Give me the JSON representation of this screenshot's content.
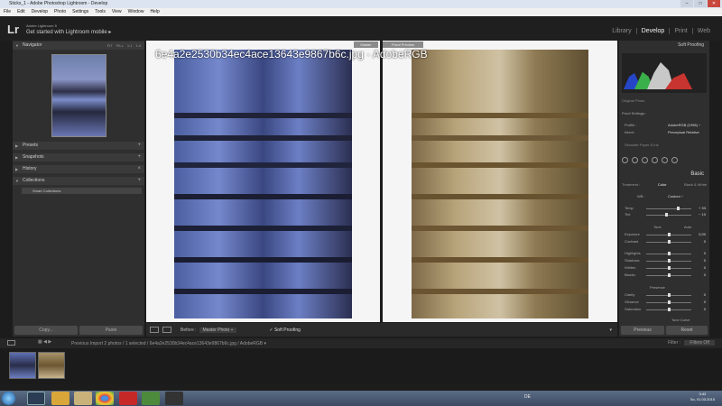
{
  "window": {
    "title": "Sticks_1 - Adobe Photoshop Lightroom - Develop",
    "buttons": [
      "–",
      "□",
      "✕"
    ]
  },
  "menu": [
    "File",
    "Edit",
    "Develop",
    "Photo",
    "Settings",
    "Tools",
    "View",
    "Window",
    "Help"
  ],
  "identity": {
    "logo": "Lr",
    "line1": "Adobe Lightroom 5",
    "line2": "Get started with Lightroom mobile ▸"
  },
  "modules": [
    {
      "label": "Library"
    },
    {
      "label": "Develop"
    },
    {
      "label": "Print"
    },
    {
      "label": "Web"
    }
  ],
  "left_panel": {
    "navigator": {
      "label": "Navigator",
      "zoom": [
        "FIT",
        "FILL",
        "1:1",
        "1:4"
      ]
    },
    "presets": "Presets",
    "snapshots": "Snapshots",
    "history": "History",
    "collections": "Collections",
    "smart_collections": "Smart Collections",
    "copy": "Copy...",
    "paste": "Paste"
  },
  "center": {
    "before_label": "Master",
    "after_label": "Proof Preview",
    "filename_overlay": "6e4a2e2530b34ec4ace13643e9867b6c.jpg · AdobeRGB"
  },
  "toolbar": {
    "before": "Before :",
    "before_value": "Master Photo ÷",
    "soft_proofing": "✓ Soft Proofing",
    "dropdown": "▾"
  },
  "right_panel": {
    "soft_proofing": "Soft Proofing",
    "original_photo": "Original Photo",
    "proof_settings": "Proof Settings :",
    "profile_label": "Profile :",
    "profile_value": "AdobeRGB (1998) ÷",
    "intent_label": "Intent :",
    "intent_value": "Perceptual  Relative",
    "simulate_paper": "Simulate Paper & Ink",
    "basic": "Basic",
    "treatment": "Treatment :",
    "color": "Color",
    "bw": "Black & White",
    "wb_label": "WB :",
    "wb_value": "Custom ÷",
    "sliders": [
      {
        "label": "Temp",
        "value": "+ 33"
      },
      {
        "label": "Tint",
        "value": "− 10"
      },
      {
        "label": "Exposure",
        "value": "0,00"
      },
      {
        "label": "Contrast",
        "value": "0"
      },
      {
        "label": "Highlights",
        "value": "0"
      },
      {
        "label": "Shadows",
        "value": "0"
      },
      {
        "label": "Whites",
        "value": "0"
      },
      {
        "label": "Blacks",
        "value": "0"
      },
      {
        "label": "Clarity",
        "value": "0"
      },
      {
        "label": "Vibrance",
        "value": "0"
      },
      {
        "label": "Saturation",
        "value": "0"
      }
    ],
    "tone": "Tone",
    "auto": "Auto",
    "presence": "Presence",
    "tone_curve": "Tone Curve",
    "previous": "Previous",
    "reset": "Reset"
  },
  "filmbar": {
    "info": "Previous Import    2 photos / 1 selected / 6e4a2e2530b34ec4ace13643e9867b6c.jpg / AdobeRGB ▾",
    "filter_label": "Filter :",
    "filter_value": "Filters Off"
  },
  "taskbar": {
    "lang": "DE",
    "time": "3:42",
    "date": "So, 01.03.2015"
  }
}
